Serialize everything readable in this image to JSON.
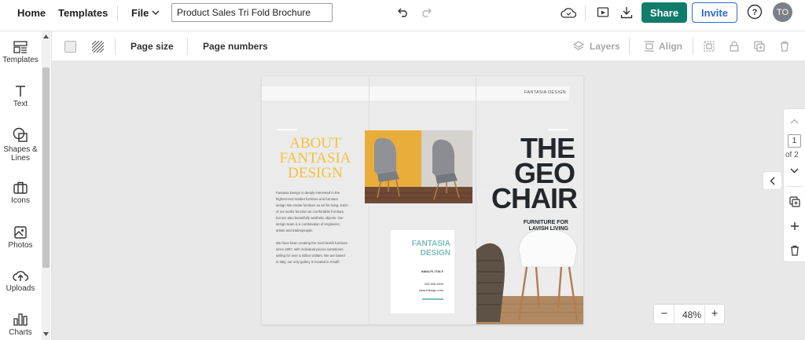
{
  "topbar": {
    "home": "Home",
    "templates": "Templates",
    "file": "File",
    "doc_title": "Product Sales Tri Fold Brochure",
    "share": "Share",
    "invite": "Invite",
    "avatar_initials": "TO"
  },
  "sidebar": {
    "items": [
      {
        "label": "Templates",
        "icon": "templates-icon"
      },
      {
        "label": "Text",
        "icon": "text-icon"
      },
      {
        "label": "Shapes &\nLines",
        "icon": "shapes-icon"
      },
      {
        "label": "Icons",
        "icon": "icons-icon"
      },
      {
        "label": "Photos",
        "icon": "photos-icon"
      },
      {
        "label": "Uploads",
        "icon": "uploads-icon"
      },
      {
        "label": "Charts",
        "icon": "charts-icon"
      }
    ]
  },
  "toolbar": {
    "page_size": "Page size",
    "page_numbers": "Page numbers",
    "layers": "Layers",
    "align": "Align"
  },
  "brochure": {
    "header_label": "FANTASIA DESIGN",
    "about_title": "ABOUT FANTASIA DESIGN",
    "about_para1": "Fantasia Design is deeply interested in the highest-end market furniture and furniture design We create furniture as art for living. Each of our works function as comfortable furniture, but are also beautifully aesthetic objects. Our design team is a combination of engineers, artists and tradespeople.",
    "about_para2": "We have been creating the most lavish furniture since 1997, with individual pieces sometimes selling for over a million dollars. We are based in Italy, our only gallery is located in Amalfi.",
    "card_title": "FANTASIA DESIGN",
    "card_location": "AMALFI, ITALY",
    "card_phone": "333.555.0000",
    "card_web": "www.fdesign.com",
    "geo_title": "THE GEO CHAIR",
    "geo_subtitle": "FURNITURE FOR LAVISH LIVING"
  },
  "pager": {
    "current": "1",
    "of_total": "of 2"
  },
  "zoom": {
    "minus": "−",
    "value": "48%",
    "plus": "+"
  },
  "colors": {
    "share_bg": "#127c6b",
    "invite_border": "#2d6bcf",
    "about_title": "#f4c23a",
    "card_accent": "#7cbfb7"
  }
}
